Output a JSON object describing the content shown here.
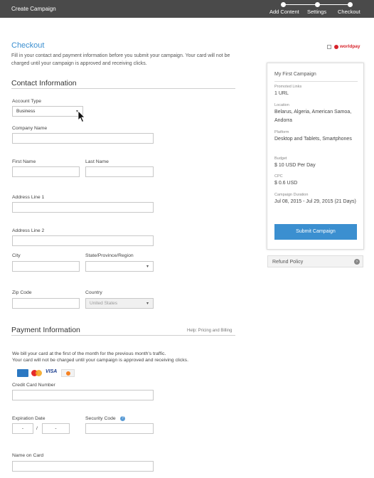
{
  "topbar": {
    "title": "Create Campaign",
    "steps": [
      "Add Content",
      "Settings",
      "Checkout"
    ]
  },
  "checkout": {
    "title": "Checkout",
    "intro": "Fill in your contact and payment information before you submit your campaign. Your card will not be charged until your campaign is approved and receiving clicks.",
    "worldpay": "worldpay"
  },
  "contact": {
    "heading": "Contact Information",
    "account_type_label": "Account Type",
    "account_type_value": "Business",
    "company_name_label": "Company Name",
    "first_name_label": "First Name",
    "last_name_label": "Last Name",
    "address1_label": "Address Line 1",
    "address2_label": "Address Line 2",
    "city_label": "City",
    "state_label": "State/Province/Region",
    "zip_label": "Zip Code",
    "country_label": "Country",
    "country_value": "United States"
  },
  "payment": {
    "heading": "Payment Information",
    "help": "Help: Pricing and Billing",
    "note_line1": "We bill your card at the first of the month for the previous month's traffic.",
    "note_line2": "Your card will not be charged until your campaign is approved and receiving clicks.",
    "cards": [
      "AMEX",
      "MC",
      "VISA",
      "DISCOVER"
    ],
    "cc_label": "Credit Card Number",
    "exp_label": "Expiration Date",
    "exp_month": "-",
    "exp_sep": "/",
    "exp_year": "-",
    "security_label": "Security Code",
    "name_label": "Name on Card"
  },
  "summary": {
    "campaign_name": "My First Campaign",
    "promoted_links_key": "Promoted Links",
    "promoted_links_val": "1 URL",
    "location_key": "Location",
    "location_val": "Belarus, Algeria, American Samoa, Andorra",
    "platform_key": "Platform",
    "platform_val": "Desktop and Tablets, Smartphones",
    "budget_key": "Budget",
    "budget_val": "$ 10 USD Per Day",
    "cpc_key": "CPC",
    "cpc_val": "$ 0.6 USD",
    "duration_key": "Campaign Duration",
    "duration_val": "Jul 08, 2015 - Jul 29, 2015 (21 Days)",
    "submit_label": "Submit Campaign"
  },
  "refund": {
    "label": "Refund Policy"
  }
}
